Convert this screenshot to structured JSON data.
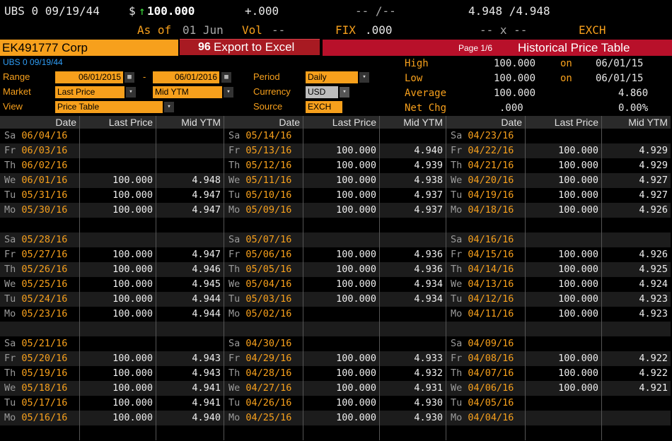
{
  "header": {
    "ticker": "UBS 0 09/19/44",
    "price_prefix": "$",
    "arrow": "↑",
    "price": "100.000",
    "change": "+.000",
    "bid_ask_dashes": "-- /--",
    "yields": "4.948 /4.948",
    "as_of_label": "As of",
    "as_of_date": "01 Jun",
    "vol_label": "Vol",
    "vol_value": "--",
    "fix_label": "FIX",
    "fix_value": ".000",
    "size_dashes": "-- x --",
    "exch": "EXCH"
  },
  "toolbar": {
    "security_field": "EK491777 Corp",
    "export_number": "96",
    "export_label": "Export to Excel",
    "page": "Page 1/6",
    "title": "Historical Price Table"
  },
  "controls": {
    "security_small": "UBS 0 09/19/44",
    "range_label": "Range",
    "range_start": "06/01/2015",
    "range_sep": "-",
    "range_end": "06/01/2016",
    "market_label": "Market",
    "market_value": "Last Price",
    "market_value2": "Mid YTM",
    "view_label": "View",
    "view_value": "Price Table",
    "period_label": "Period",
    "period_value": "Daily",
    "currency_label": "Currency",
    "currency_value": "USD",
    "source_label": "Source",
    "source_value": "EXCH"
  },
  "stats": [
    {
      "label": "High",
      "value": "100.000",
      "on": "on",
      "extra": "06/01/15"
    },
    {
      "label": "Low",
      "value": "100.000",
      "on": "on",
      "extra": "06/01/15"
    },
    {
      "label": "Average",
      "value": "100.000",
      "on": "",
      "extra": "4.860"
    },
    {
      "label": "Net Chg",
      "value": ".000",
      "on": "",
      "extra": "0.00%"
    }
  ],
  "table": {
    "headers": [
      "Date",
      "Last Price",
      "Mid YTM"
    ],
    "columns": [
      [
        [
          "Sa",
          "06/04/16",
          "",
          ""
        ],
        [
          "Fr",
          "06/03/16",
          "",
          ""
        ],
        [
          "Th",
          "06/02/16",
          "",
          ""
        ],
        [
          "We",
          "06/01/16",
          "100.000",
          "4.948"
        ],
        [
          "Tu",
          "05/31/16",
          "100.000",
          "4.947"
        ],
        [
          "Mo",
          "05/30/16",
          "100.000",
          "4.947"
        ],
        [
          "",
          "",
          "",
          ""
        ],
        [
          "Sa",
          "05/28/16",
          "",
          ""
        ],
        [
          "Fr",
          "05/27/16",
          "100.000",
          "4.947"
        ],
        [
          "Th",
          "05/26/16",
          "100.000",
          "4.946"
        ],
        [
          "We",
          "05/25/16",
          "100.000",
          "4.945"
        ],
        [
          "Tu",
          "05/24/16",
          "100.000",
          "4.944"
        ],
        [
          "Mo",
          "05/23/16",
          "100.000",
          "4.944"
        ],
        [
          "",
          "",
          "",
          ""
        ],
        [
          "Sa",
          "05/21/16",
          "",
          ""
        ],
        [
          "Fr",
          "05/20/16",
          "100.000",
          "4.943"
        ],
        [
          "Th",
          "05/19/16",
          "100.000",
          "4.943"
        ],
        [
          "We",
          "05/18/16",
          "100.000",
          "4.941"
        ],
        [
          "Tu",
          "05/17/16",
          "100.000",
          "4.941"
        ],
        [
          "Mo",
          "05/16/16",
          "100.000",
          "4.940"
        ],
        [
          "",
          "",
          "",
          ""
        ]
      ],
      [
        [
          "Sa",
          "05/14/16",
          "",
          ""
        ],
        [
          "Fr",
          "05/13/16",
          "100.000",
          "4.940"
        ],
        [
          "Th",
          "05/12/16",
          "100.000",
          "4.939"
        ],
        [
          "We",
          "05/11/16",
          "100.000",
          "4.938"
        ],
        [
          "Tu",
          "05/10/16",
          "100.000",
          "4.937"
        ],
        [
          "Mo",
          "05/09/16",
          "100.000",
          "4.937"
        ],
        [
          "",
          "",
          "",
          ""
        ],
        [
          "Sa",
          "05/07/16",
          "",
          ""
        ],
        [
          "Fr",
          "05/06/16",
          "100.000",
          "4.936"
        ],
        [
          "Th",
          "05/05/16",
          "100.000",
          "4.936"
        ],
        [
          "We",
          "05/04/16",
          "100.000",
          "4.934"
        ],
        [
          "Tu",
          "05/03/16",
          "100.000",
          "4.934"
        ],
        [
          "Mo",
          "05/02/16",
          "",
          ""
        ],
        [
          "",
          "",
          "",
          ""
        ],
        [
          "Sa",
          "04/30/16",
          "",
          ""
        ],
        [
          "Fr",
          "04/29/16",
          "100.000",
          "4.933"
        ],
        [
          "Th",
          "04/28/16",
          "100.000",
          "4.932"
        ],
        [
          "We",
          "04/27/16",
          "100.000",
          "4.931"
        ],
        [
          "Tu",
          "04/26/16",
          "100.000",
          "4.930"
        ],
        [
          "Mo",
          "04/25/16",
          "100.000",
          "4.930"
        ],
        [
          "",
          "",
          "",
          ""
        ]
      ],
      [
        [
          "Sa",
          "04/23/16",
          "",
          ""
        ],
        [
          "Fr",
          "04/22/16",
          "100.000",
          "4.929"
        ],
        [
          "Th",
          "04/21/16",
          "100.000",
          "4.929"
        ],
        [
          "We",
          "04/20/16",
          "100.000",
          "4.927"
        ],
        [
          "Tu",
          "04/19/16",
          "100.000",
          "4.927"
        ],
        [
          "Mo",
          "04/18/16",
          "100.000",
          "4.926"
        ],
        [
          "",
          "",
          "",
          ""
        ],
        [
          "Sa",
          "04/16/16",
          "",
          ""
        ],
        [
          "Fr",
          "04/15/16",
          "100.000",
          "4.926"
        ],
        [
          "Th",
          "04/14/16",
          "100.000",
          "4.925"
        ],
        [
          "We",
          "04/13/16",
          "100.000",
          "4.924"
        ],
        [
          "Tu",
          "04/12/16",
          "100.000",
          "4.923"
        ],
        [
          "Mo",
          "04/11/16",
          "100.000",
          "4.923"
        ],
        [
          "",
          "",
          "",
          ""
        ],
        [
          "Sa",
          "04/09/16",
          "",
          ""
        ],
        [
          "Fr",
          "04/08/16",
          "100.000",
          "4.922"
        ],
        [
          "Th",
          "04/07/16",
          "100.000",
          "4.922"
        ],
        [
          "We",
          "04/06/16",
          "100.000",
          "4.921"
        ],
        [
          "Tu",
          "04/05/16",
          "",
          ""
        ],
        [
          "Mo",
          "04/04/16",
          "",
          ""
        ],
        [
          "",
          "",
          "",
          ""
        ]
      ]
    ]
  },
  "colors": {
    "accent": "#f7a01c",
    "banner_red": "#b8102a",
    "row_dark": "#000000",
    "row_light": "#1c1c1c"
  }
}
